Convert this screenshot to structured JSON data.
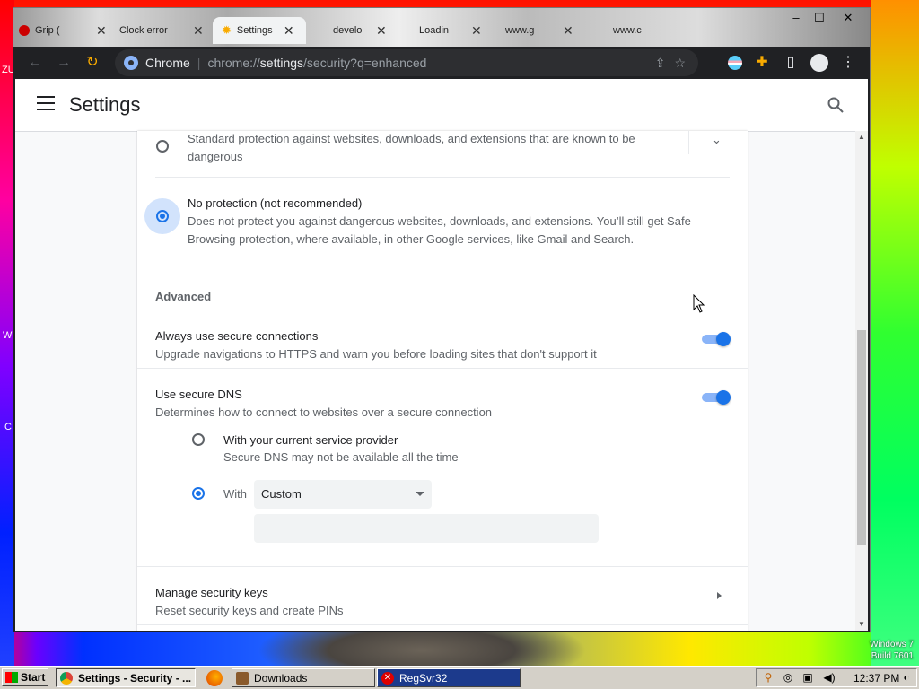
{
  "tabs": [
    {
      "title": "Grip ("
    },
    {
      "title": "Clock error"
    },
    {
      "title": "Settings"
    },
    {
      "title": "develo"
    },
    {
      "title": "Loadin"
    },
    {
      "title": "www.g"
    },
    {
      "title": "www.c"
    }
  ],
  "omnibox": {
    "chrome_label": "Chrome",
    "separator": "|",
    "url_scheme": "chrome://",
    "url_host": "settings",
    "url_rest": "/security?q=enhanced"
  },
  "header": {
    "title": "Settings"
  },
  "security": {
    "standard": {
      "desc": "Standard protection against websites, downloads, and extensions that are known to be dangerous"
    },
    "no_protection": {
      "title": "No protection (not recommended)",
      "desc": "Does not protect you against dangerous websites, downloads, and extensions. You’ll still get Safe Browsing protection, where available, in other Google services, like Gmail and Search."
    },
    "advanced_heading": "Advanced",
    "secure_connections": {
      "title": "Always use secure connections",
      "desc": "Upgrade navigations to HTTPS and warn you before loading sites that don't support it",
      "enabled": true
    },
    "secure_dns": {
      "title": "Use secure DNS",
      "desc": "Determines how to connect to websites over a secure connection",
      "enabled": true,
      "option_current": {
        "title": "With your current service provider",
        "desc": "Secure DNS may not be available all the time"
      },
      "option_with": {
        "label": "With",
        "selected": "Custom"
      }
    },
    "security_keys": {
      "title": "Manage security keys",
      "desc": "Reset security keys and create PINs"
    }
  },
  "desktop": {
    "left_letters": [
      "ZU",
      "W",
      "C"
    ],
    "watermark_line1": "Windows 7",
    "watermark_line2": "Build 7601"
  },
  "taskbar": {
    "start_label": "Start",
    "items": [
      {
        "label": "Settings - Security - ..."
      },
      {
        "label": "Downloads"
      },
      {
        "label": "RegSvr32"
      }
    ],
    "clock": "12:37 PM"
  },
  "colors": {
    "accent": "#1a73e8",
    "toggle_track": "#8ab4f8",
    "browser_frame": "#202124"
  }
}
